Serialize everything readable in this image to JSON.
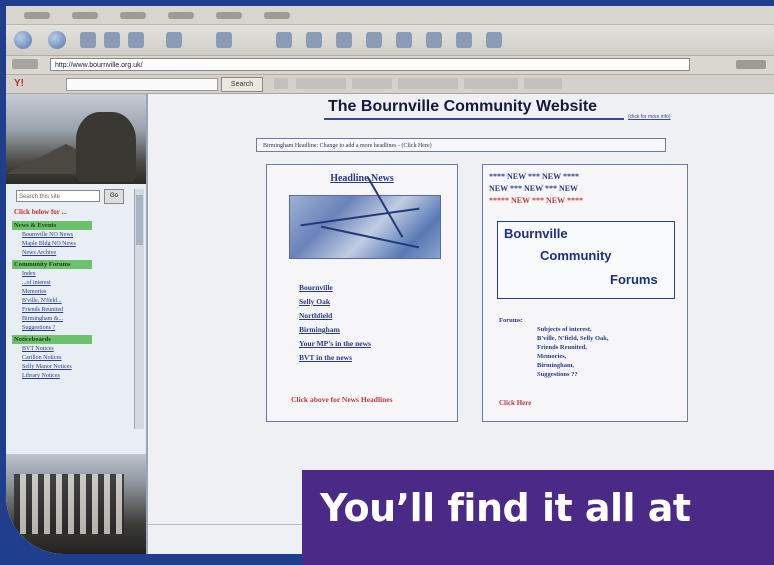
{
  "colors": {
    "frame": "#1f3e8e",
    "banner": "#4b2a87",
    "sidebar_highlight": "#6cc26a",
    "link_blue": "#2a3a8a",
    "alert_red": "#c43a3a"
  },
  "browser": {
    "address_url": "http://www.bournville.org.uk/",
    "search_button_label": "Search"
  },
  "sidebar": {
    "search_placeholder": "Search this site",
    "go_label": "Go",
    "click_label": "Click below for ...",
    "sections": [
      {
        "heading": "News & Events",
        "items": [
          "Bournville NO News",
          "Maple Bldg NO News",
          "News Archive"
        ]
      },
      {
        "heading": "Community Forums",
        "items": [
          "Index",
          "...of interest",
          "Memories",
          "B'ville, N'field...",
          "Friends Reunited",
          "Birmingham &...",
          "Suggestions ?"
        ]
      },
      {
        "heading": "Noticeboards",
        "items": [
          "BVT Notices",
          "Carillon Notices",
          "Selly Manor Notices",
          "Library Notices"
        ]
      }
    ]
  },
  "page": {
    "title": "The Bournville Community Website",
    "contact_link": "(click for more info)",
    "ticker": "Birmingham Headline: Change to add a more headlines - (Click Here)"
  },
  "headline_news": {
    "title": "Headline News",
    "links": [
      "Bournville",
      "Selly Oak",
      "Northfield",
      "Birmingham",
      "Your MP's in the news",
      "BVT in the news"
    ],
    "footer": "Click above for News Headlines"
  },
  "forums_panel": {
    "new_lines": [
      {
        "text": "**** NEW *** NEW ****",
        "red": false
      },
      {
        "text": "NEW *** NEW *** NEW",
        "red": false
      },
      {
        "text": "***** NEW *** NEW ****",
        "red": true
      }
    ],
    "logo_lines": [
      "Bournville",
      "Community",
      "Forums"
    ],
    "forums_label": "Forums:",
    "forums_list": [
      "Subjects of interest,",
      "B'ville, N'field, Selly Oak,",
      "Friends Reunited,",
      "Memories,",
      "Birmingham,",
      "Suggestions ??"
    ],
    "click_here": "Click Here"
  },
  "banner": {
    "text": "You’ll find it all at"
  }
}
